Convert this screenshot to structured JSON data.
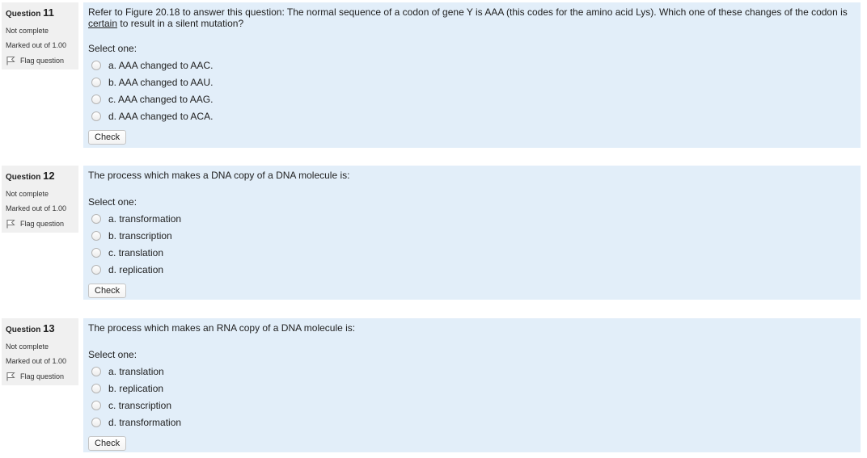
{
  "questions": [
    {
      "label": "Question",
      "number": "11",
      "state": "Not complete",
      "grade": "Marked out of 1.00",
      "flag_label": "Flag question",
      "text_before": "Refer to Figure 20.18 to answer this question:  The normal sequence of a codon of gene Y is AAA (this codes for the amino acid Lys).  Which one of these changes of the codon is ",
      "text_underlined": "certain",
      "text_after": " to result in a silent mutation?",
      "prompt": "Select one:",
      "options": [
        "a. AAA changed to AAC.",
        "b. AAA changed to AAU.",
        "c. AAA changed to AAG.",
        "d. AAA changed to ACA."
      ],
      "check_label": "Check"
    },
    {
      "label": "Question",
      "number": "12",
      "state": "Not complete",
      "grade": "Marked out of 1.00",
      "flag_label": "Flag question",
      "text_before": "The process which makes a DNA copy of a DNA molecule is:",
      "text_underlined": "",
      "text_after": "",
      "prompt": "Select one:",
      "options": [
        "a. transformation",
        "b. transcription",
        "c. translation",
        "d. replication"
      ],
      "check_label": "Check"
    },
    {
      "label": "Question",
      "number": "13",
      "state": "Not complete",
      "grade": "Marked out of 1.00",
      "flag_label": "Flag question",
      "text_before": "The process which makes an RNA copy of a DNA molecule is:",
      "text_underlined": "",
      "text_after": "",
      "prompt": "Select one:",
      "options": [
        "a. translation",
        "b. replication",
        "c. transcription",
        "d. transformation"
      ],
      "check_label": "Check"
    }
  ],
  "colors": {
    "content_bg": "#e2eef9",
    "info_bg": "#f0f0f0"
  },
  "icons": {
    "flag": "flag-icon",
    "radio": "radio-button"
  }
}
